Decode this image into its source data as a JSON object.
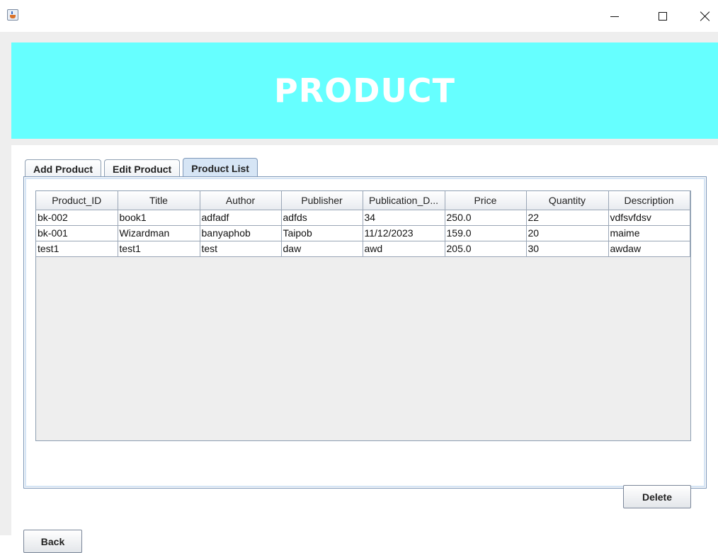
{
  "window": {
    "controls": {
      "minimize_icon": "minimize-icon",
      "maximize_icon": "maximize-icon",
      "close_icon": "close-icon"
    }
  },
  "banner": {
    "title": "PRODUCT",
    "background": "#66ffff",
    "text_color": "#ffffff"
  },
  "tabs": [
    {
      "label": "Add Product",
      "active": false
    },
    {
      "label": "Edit Product",
      "active": false
    },
    {
      "label": "Product List",
      "active": true
    }
  ],
  "table": {
    "columns": [
      "Product_ID",
      "Title",
      "Author",
      "Publisher",
      "Publication_D...",
      "Price",
      "Quantity",
      "Description"
    ],
    "rows": [
      [
        "bk-002",
        "book1",
        "adfadf",
        "adfds",
        "34",
        "250.0",
        "22",
        "vdfsvfdsv"
      ],
      [
        "bk-001",
        "Wizardman",
        "banyaphob",
        "Taipob",
        "11/12/2023",
        "159.0",
        "20",
        "maime"
      ],
      [
        "test1",
        "test1",
        "test",
        "daw",
        "awd",
        "205.0",
        "30",
        "awdaw"
      ]
    ]
  },
  "buttons": {
    "delete_label": "Delete",
    "back_label": "Back"
  }
}
